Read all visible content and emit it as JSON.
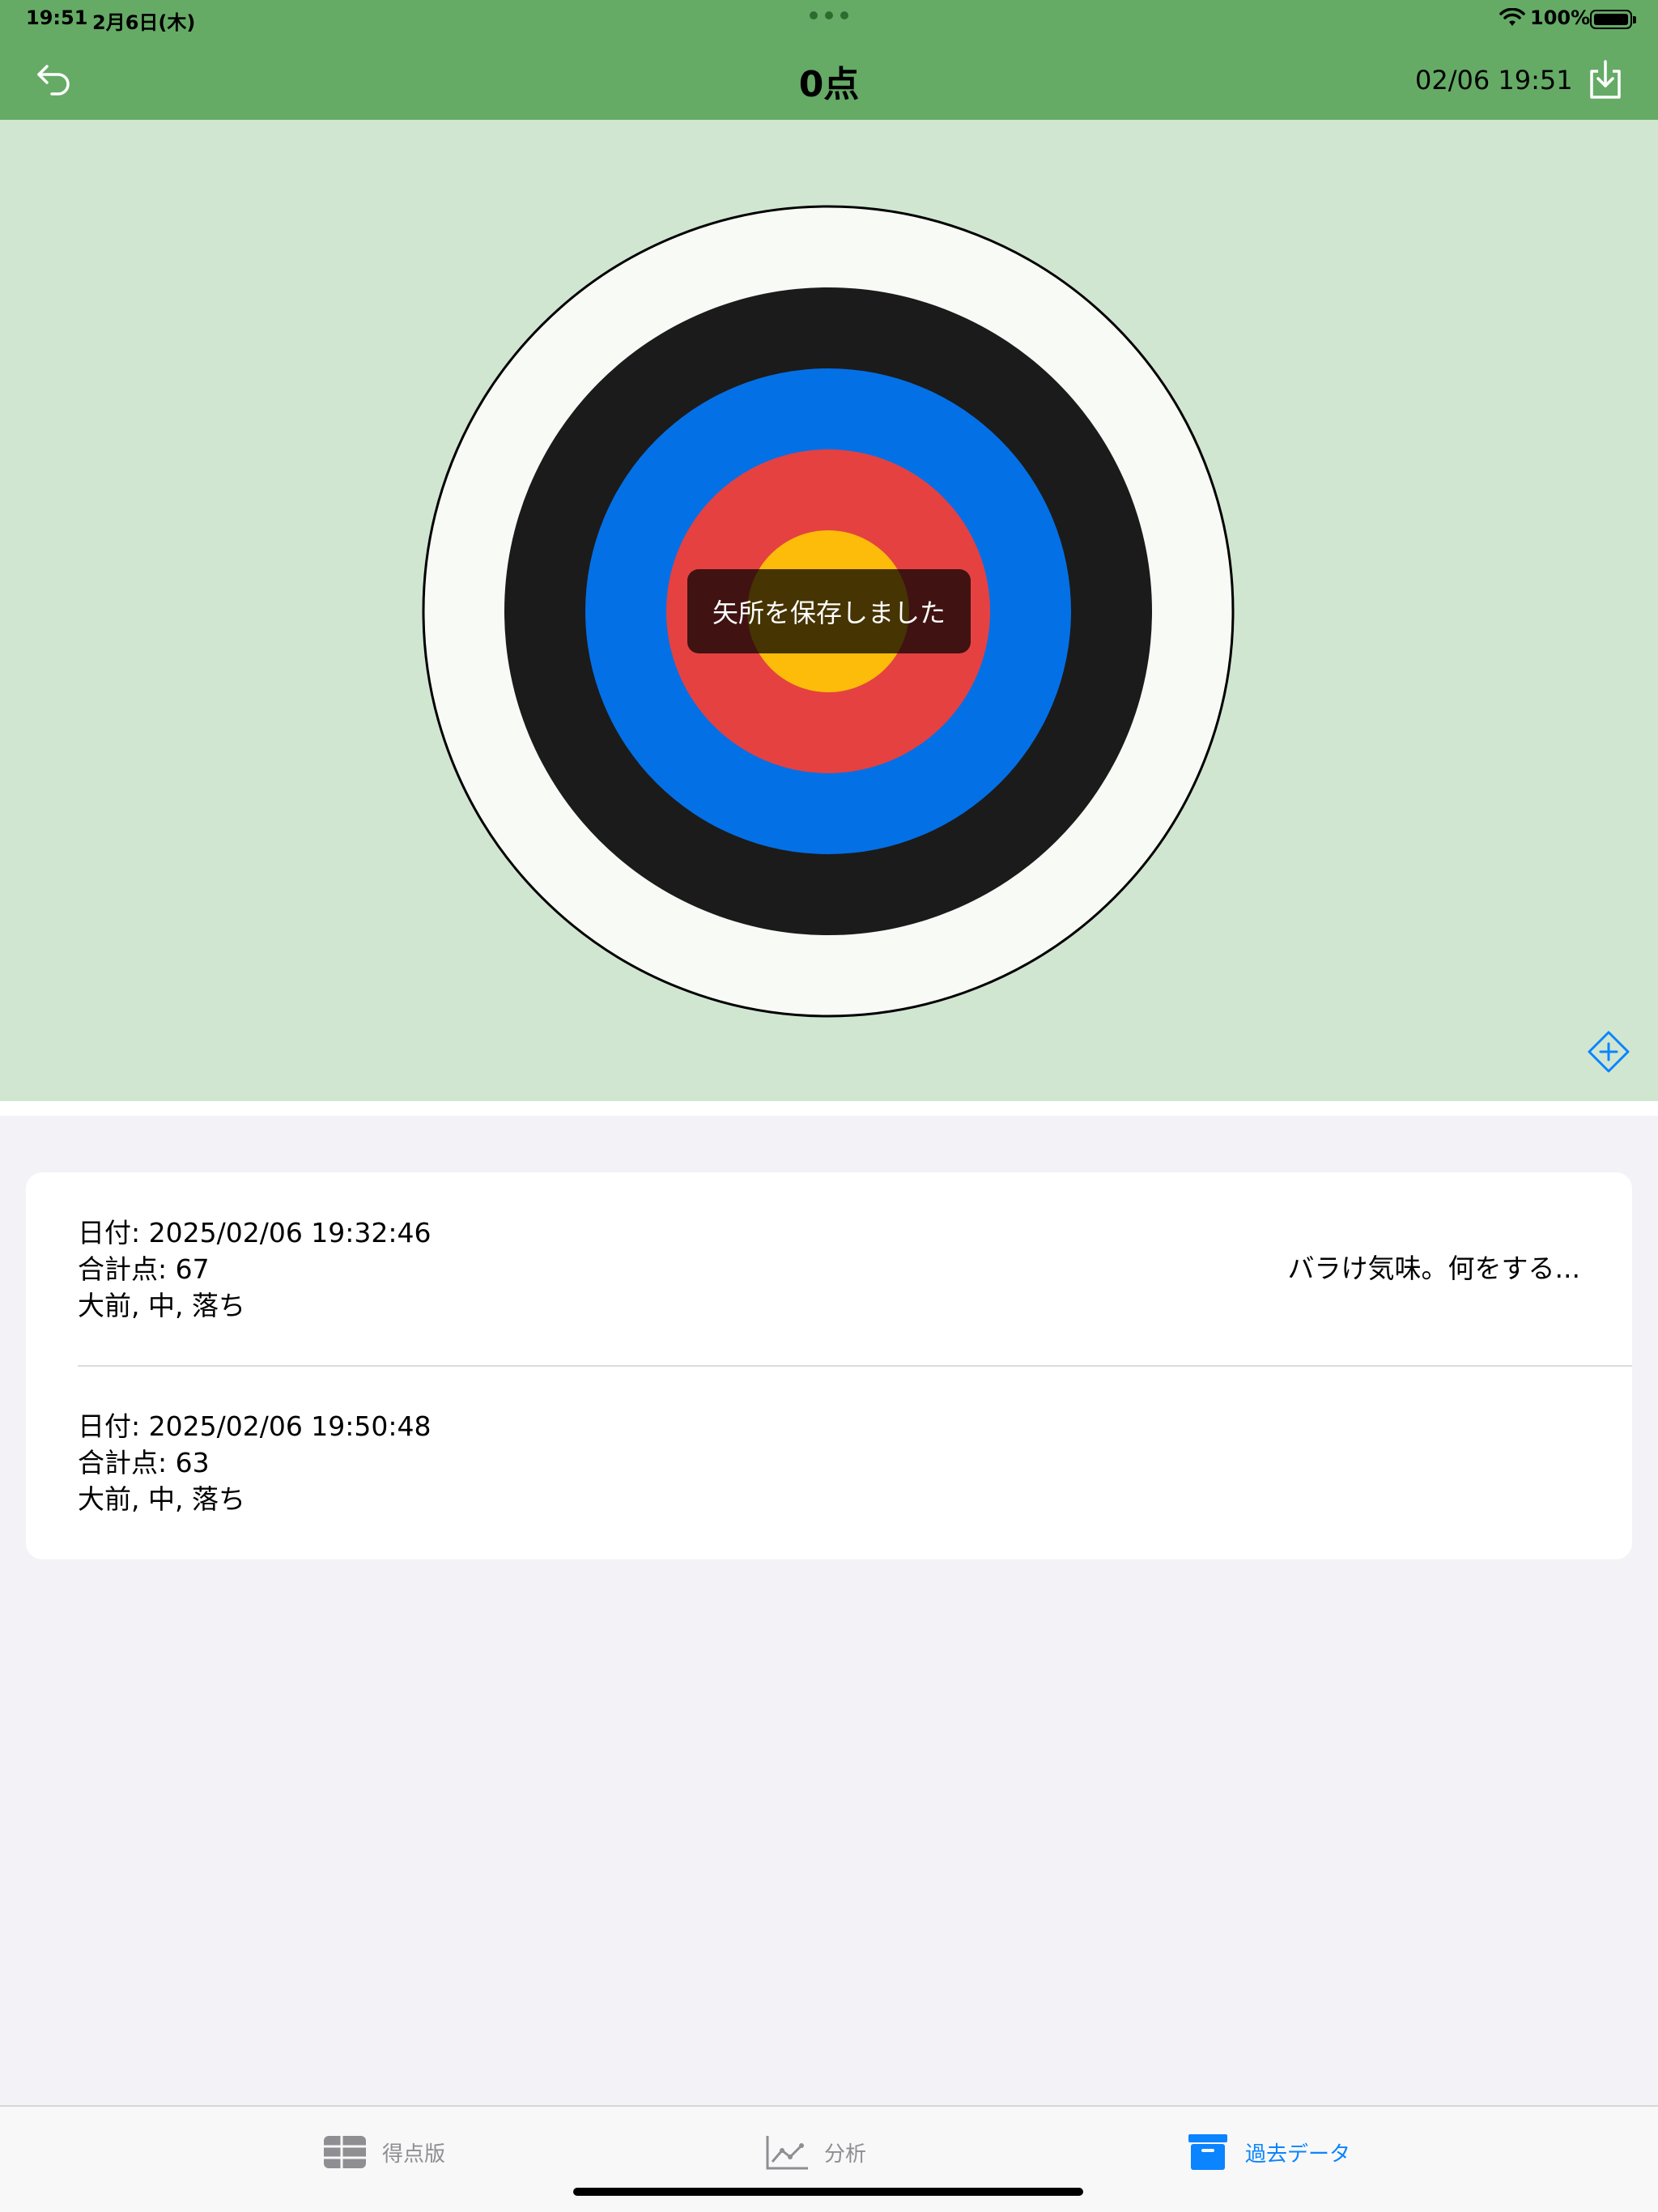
{
  "status_bar": {
    "time": "19:51",
    "date": "2月6日(木)",
    "battery": "100%"
  },
  "nav": {
    "title": "0点",
    "datetime": "02/06 19:51",
    "back_icon": "undo-arrow-icon",
    "download_icon": "tray-arrow-down-icon"
  },
  "target": {
    "toast": "矢所を保存しました",
    "ring_colors": [
      "#f8faf6",
      "#1b1b1b",
      "#0470e6",
      "#e54141",
      "#fcbc09"
    ],
    "add_icon": "diamond-plus-icon"
  },
  "history": {
    "records": [
      {
        "date": "日付: 2025/02/06 19:32:46",
        "total": "合計点: 67",
        "hits": "大前, 中, 落ち",
        "note": "バラけ気味。何をする..."
      },
      {
        "date": "日付: 2025/02/06 19:50:48",
        "total": "合計点: 63",
        "hits": "大前, 中, 落ち",
        "note": ""
      }
    ]
  },
  "tabs": [
    {
      "label": "得点版",
      "icon": "table-icon",
      "active": false
    },
    {
      "label": "分析",
      "icon": "line-chart-icon",
      "active": false
    },
    {
      "label": "過去データ",
      "icon": "archive-box-icon",
      "active": true
    }
  ],
  "colors": {
    "header_green": "#65ab66",
    "target_bg": "#d0e6d1",
    "accent_blue": "#0a84ff"
  }
}
